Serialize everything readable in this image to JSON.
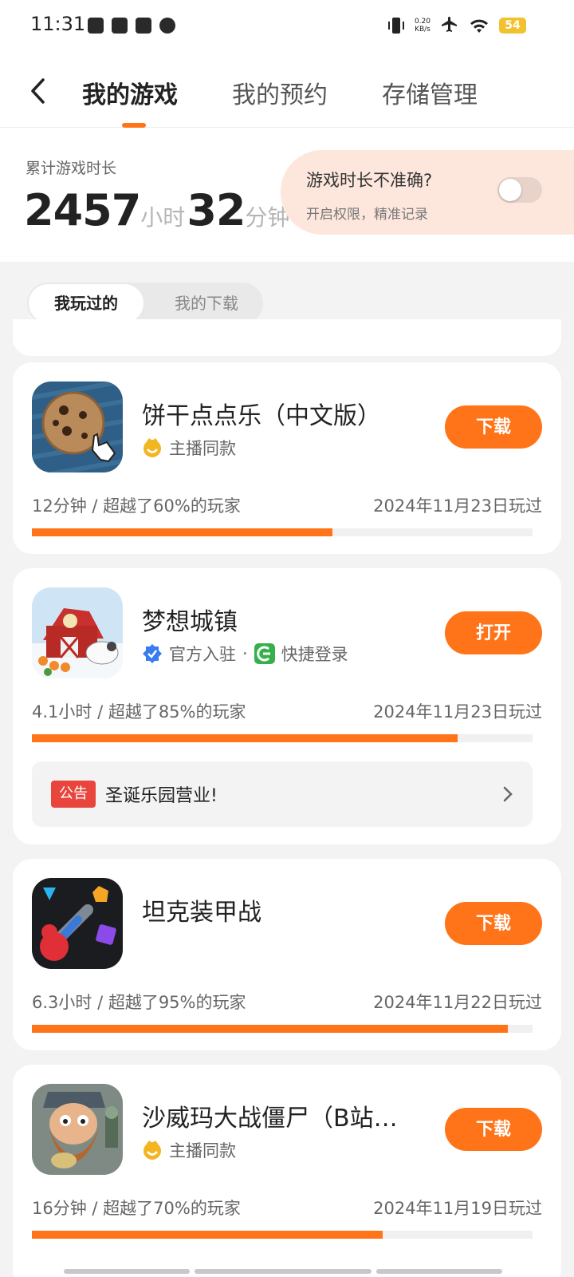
{
  "status_bar": {
    "time": "11:31",
    "net_speed_value": "0.20",
    "net_speed_unit": "KB/s",
    "battery": "54"
  },
  "header": {
    "tabs": [
      {
        "label": "我的游戏",
        "active": true
      },
      {
        "label": "我的预约",
        "active": false
      },
      {
        "label": "存储管理",
        "active": false
      }
    ]
  },
  "summary": {
    "label": "累计游戏时长",
    "hours": "2457",
    "hours_unit": "小时",
    "minutes": "32",
    "minutes_unit": "分钟",
    "tip_title": "游戏时长不准确?",
    "tip_subtitle": "开启权限，精准记录",
    "toggle_on": false
  },
  "segment": {
    "options": [
      {
        "label": "我玩过的",
        "selected": true
      },
      {
        "label": "我的下载",
        "selected": false
      }
    ]
  },
  "games": [
    {
      "name": "饼干点点乐（中文版）",
      "icon": "cookie-icon",
      "tags": [
        {
          "icon": "streamer-face-icon",
          "label": "主播同款"
        }
      ],
      "action": "下载",
      "stat": "12分钟 / 超越了60%的玩家",
      "date": "2024年11月23日玩过",
      "progress": 0.6
    },
    {
      "name": "梦想城镇",
      "icon": "farm-barn-icon",
      "tags": [
        {
          "icon": "verified-badge-icon",
          "label": "官方入驻"
        },
        {
          "icon": "quick-login-icon",
          "label": "快捷登录"
        }
      ],
      "tag_separator": "·",
      "action": "打开",
      "stat": "4.1小时 / 超越了85%的玩家",
      "date": "2024年11月23日玩过",
      "progress": 0.85,
      "notice": {
        "badge": "公告",
        "text": "圣诞乐园营业!"
      }
    },
    {
      "name": "坦克装甲战",
      "icon": "tank-shapes-icon",
      "tags": [],
      "action": "下载",
      "stat": "6.3小时 / 超越了95%的玩家",
      "date": "2024年11月22日玩过",
      "progress": 0.95
    },
    {
      "name": "沙威玛大战僵尸（B站…",
      "icon": "bearded-man-icon",
      "tags": [
        {
          "icon": "streamer-face-icon",
          "label": "主播同款"
        }
      ],
      "action": "下载",
      "stat": "16分钟 / 超越了70%的玩家",
      "date": "2024年11月19日玩过",
      "progress": 0.7
    }
  ],
  "colors": {
    "accent": "#ff7418",
    "tip_bg": "#fde7dd",
    "notice_badge": "#e8453c",
    "verified": "#3a7bf0",
    "quick_login": "#36b04a",
    "streamer": "#f3b623"
  }
}
